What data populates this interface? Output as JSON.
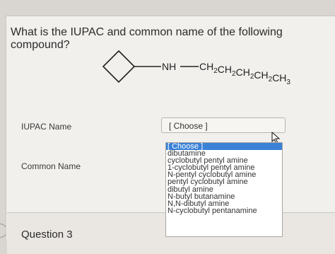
{
  "question": {
    "text": "What is the IUPAC and common name of the following compound?"
  },
  "structure": {
    "nh_label": "NH",
    "chain_label": "CH2CH2CH2CH2CH3"
  },
  "fields": [
    {
      "label": "IUPAC Name",
      "selected": "[ Choose ]"
    },
    {
      "label": "Common Name"
    }
  ],
  "dropdown": {
    "options": [
      "[ Choose ]",
      "dibutamine",
      "cyclobutyl pentyl amine",
      "1-cyclobutyl pentyl amine",
      "N-pentyl cyclobutyl amine",
      "pentyl cyclobutyl amine",
      "dibutyl amine",
      "N-butyl butanamine",
      "N,N-dibutyl amine",
      "N-cyclobutyl pentanamine"
    ],
    "highlighted_index": 0
  },
  "next_question": {
    "label": "Question 3"
  }
}
